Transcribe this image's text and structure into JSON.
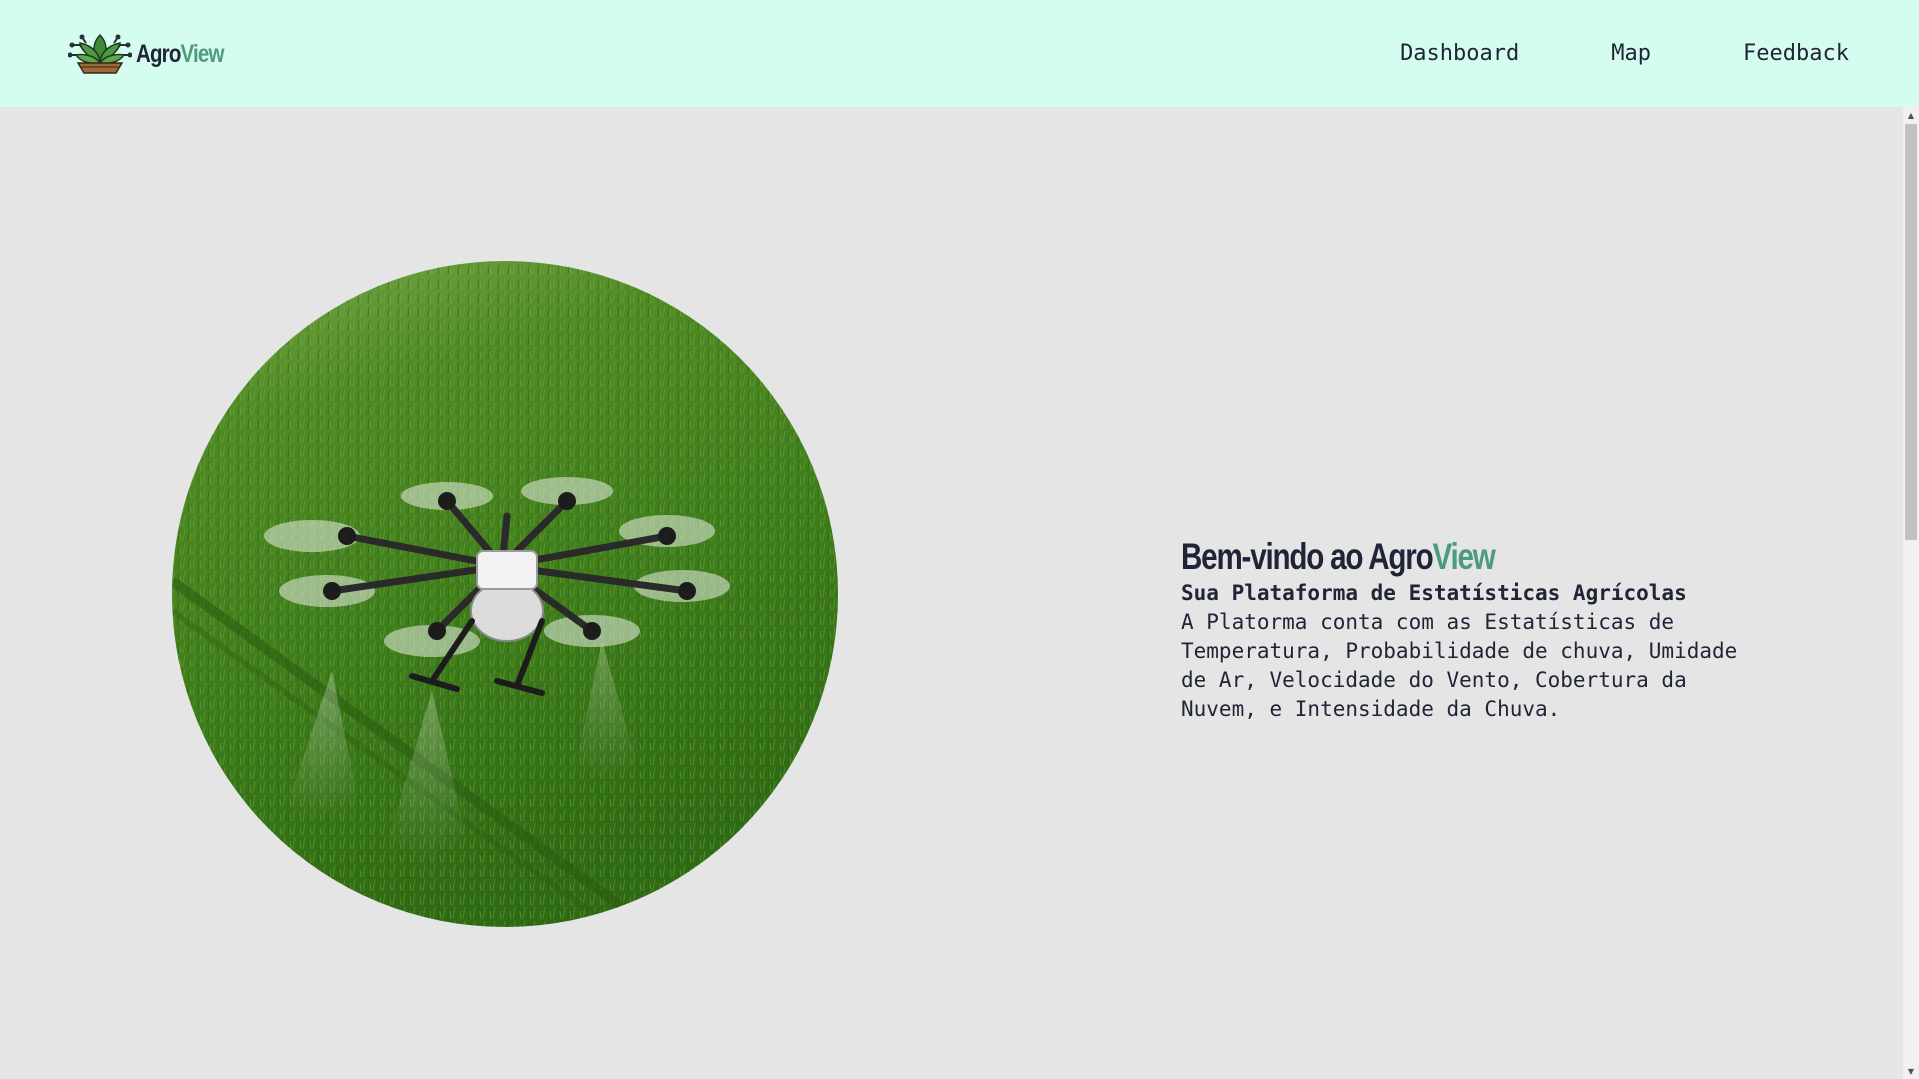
{
  "header": {
    "logo_text": "Agro",
    "logo_accent": "View",
    "nav": [
      {
        "label": "Dashboard"
      },
      {
        "label": "Map"
      },
      {
        "label": "Feedback"
      }
    ]
  },
  "hero": {
    "title_prefix": "Bem-vindo ao Agro",
    "title_accent": "View",
    "subtitle": "Sua Plataforma de Estatísticas Agrícolas",
    "description": "A Platorma conta com as Estatísticas de Temperatura, Probabilidade de chuva, Umidade de Ar, Velocidade do Vento, Cobertura da Nuvem, e Intensidade da Chuva."
  },
  "colors": {
    "header_bg": "#d5fdef",
    "page_bg": "#e5e5e5",
    "text_dark": "#1f2437",
    "accent_green": "#4e9a7f"
  },
  "icons": {
    "logo": "plant-circuit-logo-icon",
    "scroll_up": "scroll-up-arrow-icon",
    "scroll_down": "scroll-down-arrow-icon"
  }
}
